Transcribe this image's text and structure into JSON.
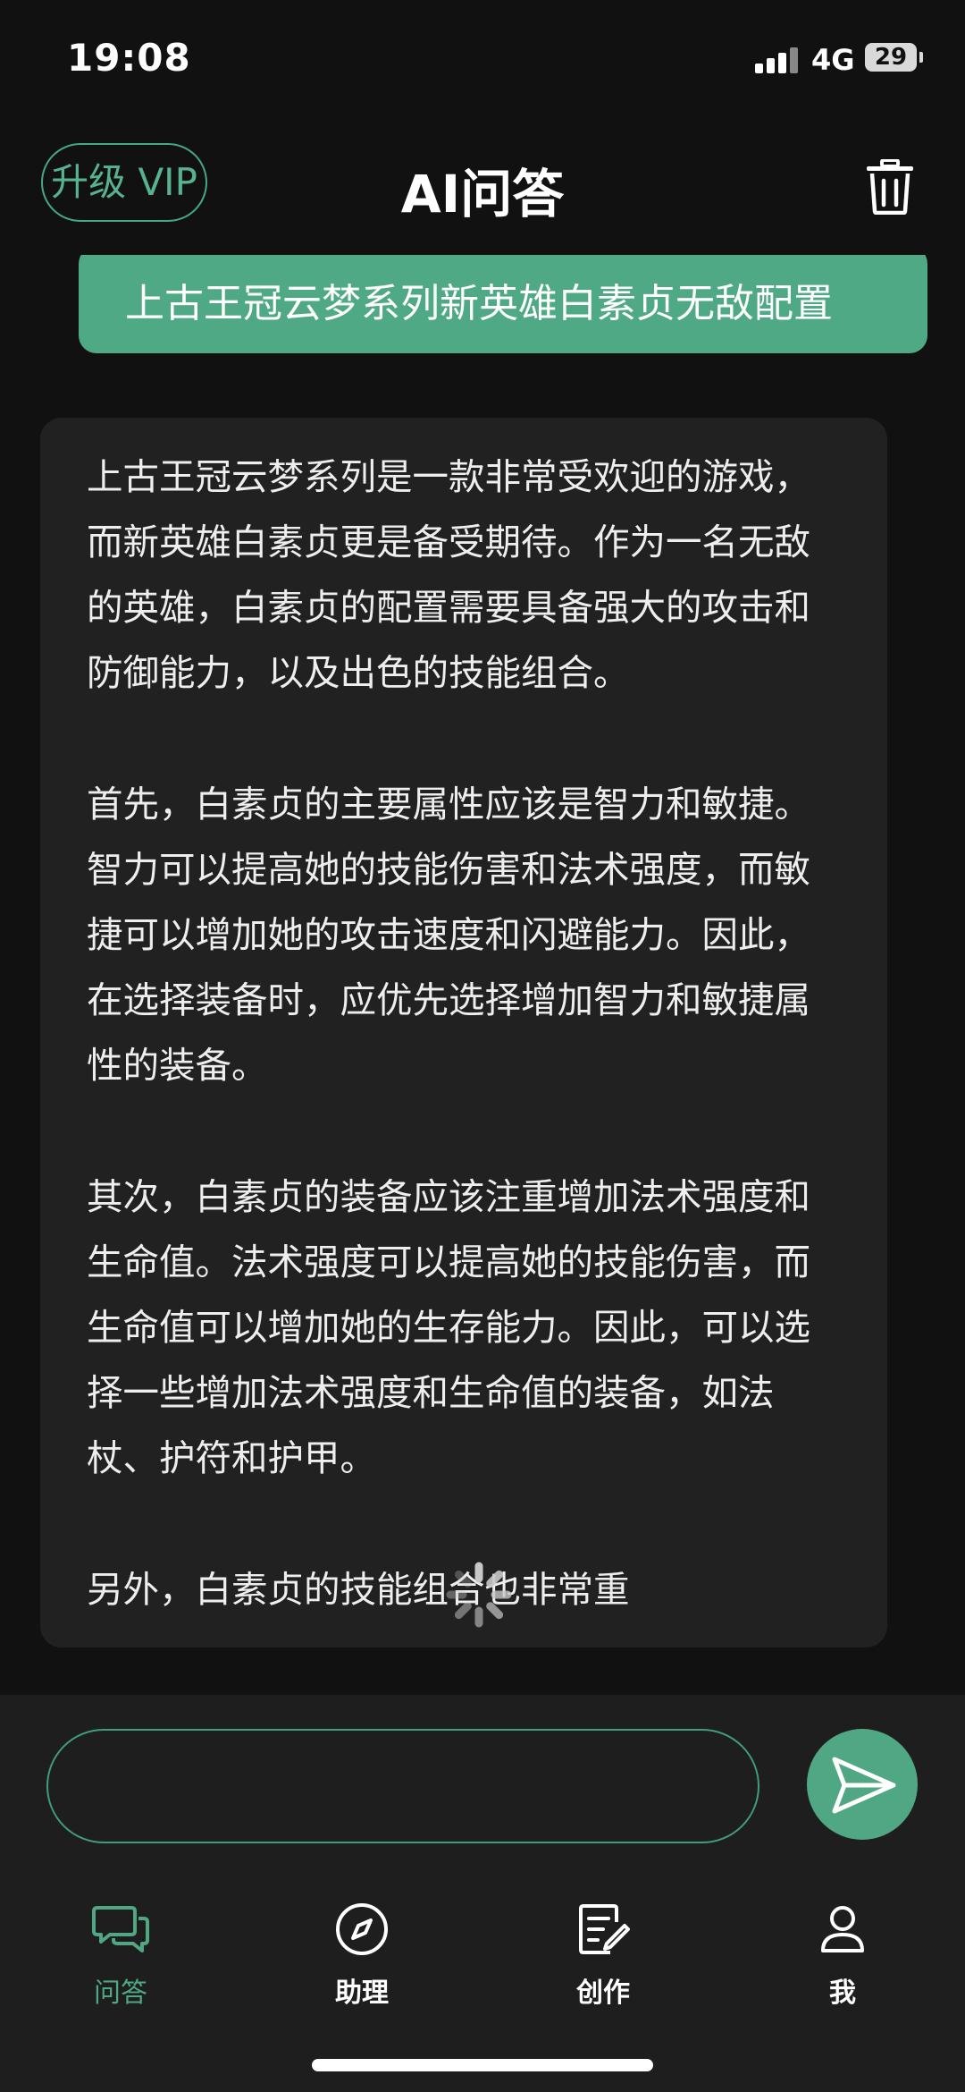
{
  "status_bar": {
    "time": "19:08",
    "network": "4G",
    "battery": "29"
  },
  "header": {
    "vip_label": "升级 VIP",
    "title": "AI问答"
  },
  "chat": {
    "user_message": "上古王冠云梦系列新英雄白素贞无敌配置",
    "ai_paragraphs": [
      "上古王冠云梦系列是一款非常受欢迎的游戏，而新英雄白素贞更是备受期待。作为一名无敌的英雄，白素贞的配置需要具备强大的攻击和防御能力，以及出色的技能组合。",
      "首先，白素贞的主要属性应该是智力和敏捷。智力可以提高她的技能伤害和法术强度，而敏捷可以增加她的攻击速度和闪避能力。因此，在选择装备时，应优先选择增加智力和敏捷属性的装备。",
      "其次，白素贞的装备应该注重增加法术强度和生命值。法术强度可以提高她的技能伤害，而生命值可以增加她的生存能力。因此，可以选择一些增加法术强度和生命值的装备，如法杖、护符和护甲。",
      "另外，白素贞的技能组合也非常重"
    ]
  },
  "input": {
    "value": "",
    "placeholder": ""
  },
  "nav": [
    {
      "label": "问答",
      "icon": "chat-bubbles-icon",
      "active": true
    },
    {
      "label": "助理",
      "icon": "compass-icon",
      "active": false
    },
    {
      "label": "创作",
      "icon": "edit-document-icon",
      "active": false
    },
    {
      "label": "我",
      "icon": "person-icon",
      "active": false
    }
  ],
  "colors": {
    "accent": "#4fa883",
    "background": "#111111",
    "bubble": "#212121",
    "bar": "#1e1e1e"
  }
}
